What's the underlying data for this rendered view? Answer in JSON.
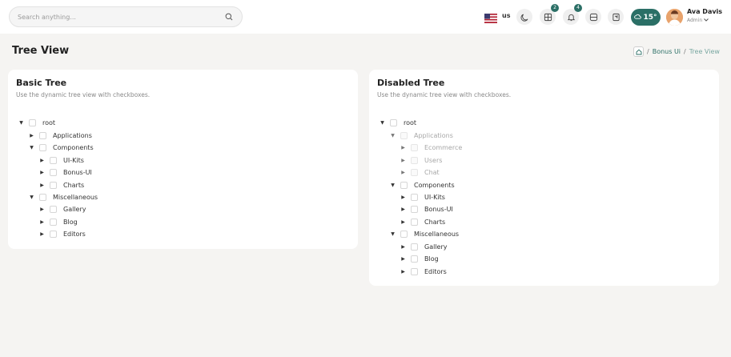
{
  "header": {
    "search_placeholder": "Search anything...",
    "language": "us",
    "notifications": {
      "apps_count": "2",
      "bell_count": "4"
    },
    "weather": "15°",
    "user": {
      "name": "Ava Davis",
      "role": "Admin"
    }
  },
  "page": {
    "title": "Tree View",
    "breadcrumb": {
      "section": "Bonus Ui",
      "current": "Tree View",
      "separator": "/"
    }
  },
  "basic_tree": {
    "title": "Basic Tree",
    "subtitle": "Use the dynamic tree view with checkboxes.",
    "nodes": [
      {
        "label": "root",
        "caret": "▼"
      },
      {
        "label": "Applications",
        "caret": "▶"
      },
      {
        "label": "Components",
        "caret": "▼"
      },
      {
        "label": "UI-Kits",
        "caret": "▶"
      },
      {
        "label": "Bonus-UI",
        "caret": "▶"
      },
      {
        "label": "Charts",
        "caret": "▶"
      },
      {
        "label": "Miscellaneous",
        "caret": "▼"
      },
      {
        "label": "Gallery",
        "caret": "▶"
      },
      {
        "label": "Blog",
        "caret": "▶"
      },
      {
        "label": "Editors",
        "caret": "▶"
      }
    ]
  },
  "disabled_tree": {
    "title": "Disabled Tree",
    "subtitle": "Use the dynamic tree view with checkboxes.",
    "nodes": [
      {
        "label": "root",
        "caret": "▼"
      },
      {
        "label": "Applications",
        "caret": "▼"
      },
      {
        "label": "Ecommerce",
        "caret": "▶"
      },
      {
        "label": "Users",
        "caret": "▶"
      },
      {
        "label": "Chat",
        "caret": "▶"
      },
      {
        "label": "Components",
        "caret": "▼"
      },
      {
        "label": "UI-Kits",
        "caret": "▶"
      },
      {
        "label": "Bonus-UI",
        "caret": "▶"
      },
      {
        "label": "Charts",
        "caret": "▶"
      },
      {
        "label": "Miscellaneous",
        "caret": "▼"
      },
      {
        "label": "Gallery",
        "caret": "▶"
      },
      {
        "label": "Blog",
        "caret": "▶"
      },
      {
        "label": "Editors",
        "caret": "▶"
      }
    ]
  },
  "colors": {
    "accent": "#2b6f66",
    "background": "#f5f4f2",
    "card": "#ffffff"
  }
}
